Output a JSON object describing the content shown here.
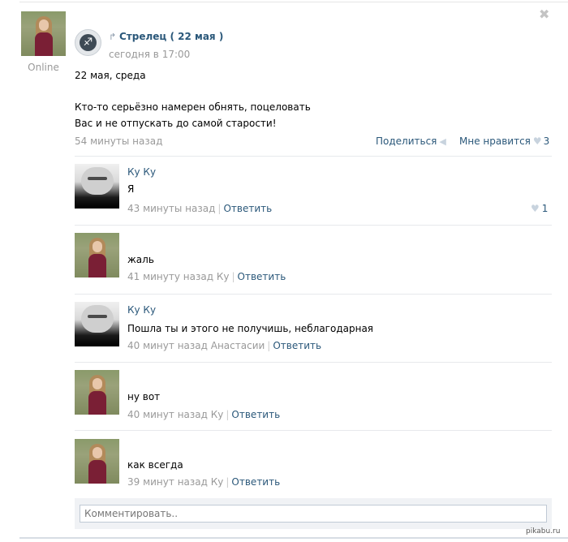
{
  "author": {
    "status": "Online"
  },
  "post": {
    "close_icon": "close-icon",
    "group_name": "Стрелец ( 22 мая )",
    "group_time": "сегодня в 17:00",
    "lines": [
      "22 мая, среда",
      "Кто-то серьёзно намерен обнять, поцеловать",
      "Вас и не отпускать до самой старости!"
    ],
    "time": "54 минуты назад",
    "share_label": "Поделиться",
    "like_label": "Мне нравится",
    "like_count": "3"
  },
  "comments": [
    {
      "author": "Ку Ку",
      "text": "Я",
      "time": "43 минуты назад",
      "reply_to": "",
      "reply_label": "Ответить",
      "likes": "1",
      "avatar": "man"
    },
    {
      "author": "",
      "text": "жаль",
      "time": "41 минуту назад",
      "reply_to": "Ку",
      "reply_label": "Ответить",
      "likes": "",
      "avatar": "girl"
    },
    {
      "author": "Ку Ку",
      "text": "Пошла ты и этого не получишь, неблагодарная",
      "time": "40 минут назад",
      "reply_to": "Анастасии",
      "reply_label": "Ответить",
      "likes": "",
      "avatar": "man"
    },
    {
      "author": "",
      "text": "ну вот",
      "time": "40 минут назад",
      "reply_to": "Ку",
      "reply_label": "Ответить",
      "likes": "",
      "avatar": "girl"
    },
    {
      "author": "",
      "text": "как всегда",
      "time": "39 минут назад",
      "reply_to": "Ку",
      "reply_label": "Ответить",
      "likes": "",
      "avatar": "girl"
    }
  ],
  "comment_box": {
    "placeholder": "Комментировать.."
  },
  "watermark": "pikabu.ru",
  "colors": {
    "link": "#2b587a",
    "muted": "#999999",
    "divider": "#e7e9ec"
  }
}
